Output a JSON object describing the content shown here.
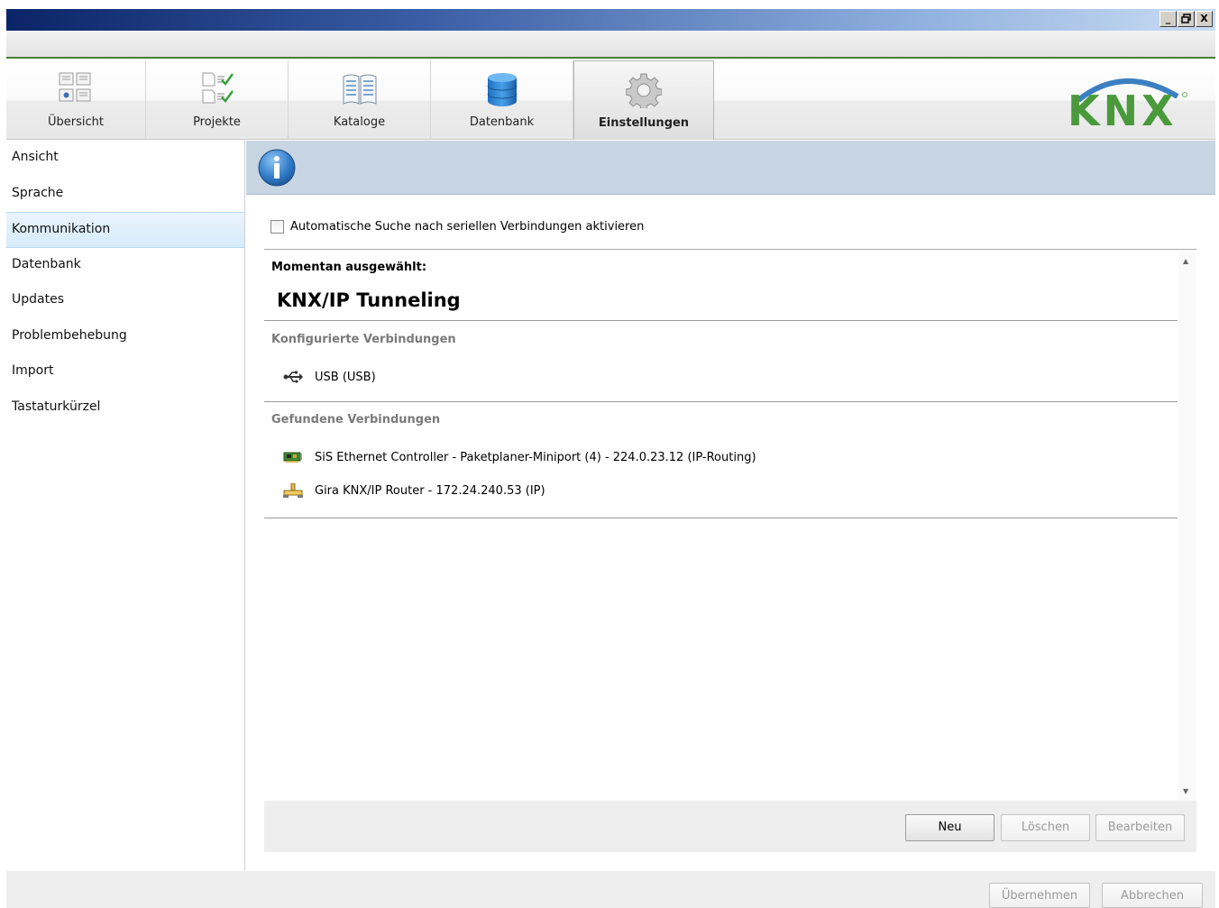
{
  "window": {
    "controls": {
      "minimize": "_",
      "restore": "▫",
      "close": "X"
    }
  },
  "tabs": [
    {
      "label": "Übersicht",
      "icon": "overview-icon"
    },
    {
      "label": "Projekte",
      "icon": "projects-icon"
    },
    {
      "label": "Kataloge",
      "icon": "catalog-book-icon"
    },
    {
      "label": "Datenbank",
      "icon": "database-icon"
    },
    {
      "label": "Einstellungen",
      "icon": "gear-icon",
      "active": true
    }
  ],
  "logo": {
    "text": "KNX",
    "color": "#4a9a3c",
    "arc_color": "#3a7fc1"
  },
  "sidebar": {
    "items": [
      {
        "label": "Ansicht"
      },
      {
        "label": "Sprache"
      },
      {
        "label": "Kommunikation",
        "selected": true
      },
      {
        "label": "Datenbank"
      },
      {
        "label": "Updates"
      },
      {
        "label": "Problembehebung"
      },
      {
        "label": "Import"
      },
      {
        "label": "Tastaturkürzel"
      }
    ]
  },
  "content": {
    "info_icon": "info-icon",
    "auto_search_label": "Automatische Suche nach seriellen Verbindungen aktivieren",
    "auto_search_checked": false,
    "current_label": "Momentan ausgewählt:",
    "current_value": "KNX/IP Tunneling",
    "configured_title": "Konfigurierte Verbindungen",
    "configured": [
      {
        "label": "USB (USB)",
        "icon": "usb-icon"
      }
    ],
    "found_title": "Gefundene Verbindungen",
    "found": [
      {
        "label": "SiS Ethernet Controller - Paketplaner-Miniport (4) - 224.0.23.12 (IP-Routing)",
        "icon": "network-card-icon"
      },
      {
        "label": "Gira KNX/IP Router - 172.24.240.53 (IP)",
        "icon": "network-router-icon"
      }
    ],
    "buttons": {
      "new": "Neu",
      "delete": "Löschen",
      "edit": "Bearbeiten"
    }
  },
  "footer": {
    "apply": "Übernehmen",
    "cancel": "Abbrechen"
  }
}
